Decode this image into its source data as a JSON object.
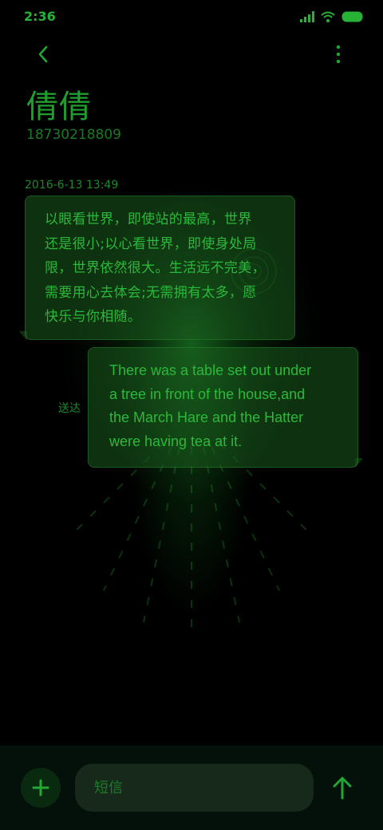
{
  "status_bar": {
    "time": "2:36",
    "icons": [
      "signal-icon",
      "wifi-icon",
      "battery-icon"
    ]
  },
  "header": {
    "back_icon": "chevron-left-icon",
    "more_icon": "more-vertical-icon"
  },
  "contact": {
    "name": "倩倩",
    "number": "18730218809"
  },
  "conversation": {
    "timestamp": "2016-6-13 13:49",
    "messages": [
      {
        "direction": "incoming",
        "text": "以眼看世界，即使站的最高，世界\n还是很小;以心看世界，即使身处局\n限，世界依然很大。生活远不完美，\n需要用心去体会;无需拥有太多，愿\n快乐与你相随。"
      },
      {
        "direction": "outgoing",
        "text": "There was a table set out under\na tree in front of the house,and\nthe March Hare and the Hatter\nwere having tea at it.",
        "status": "送达"
      }
    ]
  },
  "composer": {
    "add_icon": "plus-icon",
    "placeholder": "短信",
    "value": "",
    "send_icon": "arrow-up-icon"
  },
  "colors": {
    "background": "#000000",
    "accent": "#1f9f2d",
    "bubble": "#195a1e",
    "input_bar": "#03110a"
  }
}
